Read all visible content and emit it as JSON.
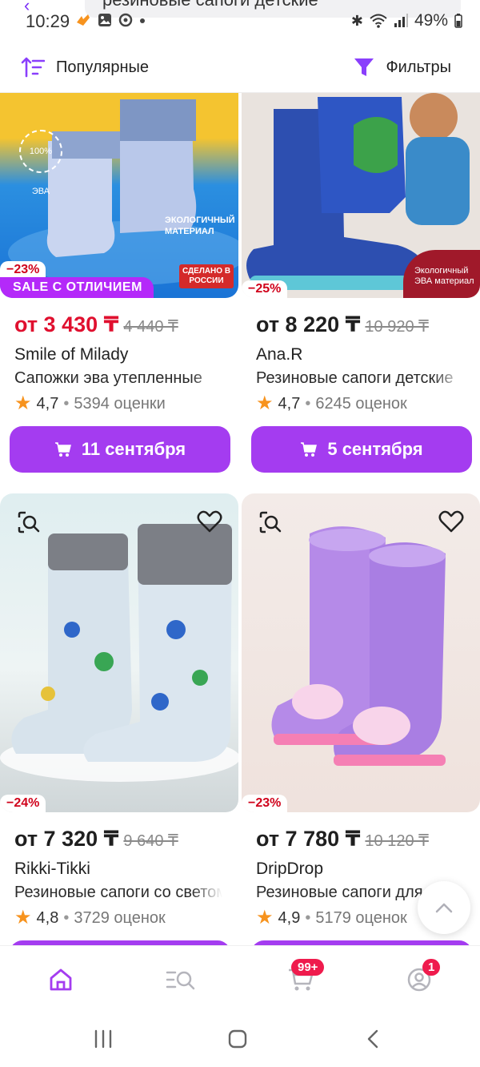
{
  "status": {
    "time": "10:29",
    "battery": "49%",
    "search_query": "резиновые сапоги детские"
  },
  "toolbar": {
    "sort_label": "Популярные",
    "filter_label": "Фильтры"
  },
  "products": [
    {
      "discount": "−23%",
      "sale_badge": "SALE С ОТЛИЧИЕМ",
      "price": "от 3 430 ₸",
      "old_price": "4 440 ₸",
      "brand": "Smile of Milady",
      "title": "Сапожки эва утепленные",
      "rating": "4,7",
      "reviews": "5394 оценки",
      "delivery": "11 сентября",
      "image_text": [
        "100% ЭВА",
        "ЭКОЛОГИЧНЫЙ МАТЕРИАЛ",
        "СДЕЛАНО В РОССИИ"
      ]
    },
    {
      "discount": "−25%",
      "price": "от 8 220 ₸",
      "old_price": "10 920 ₸",
      "brand": "Ana.R",
      "title": "Резиновые сапоги детские",
      "rating": "4,7",
      "reviews": "6245 оценок",
      "delivery": "5 сентября",
      "image_text": [
        "Экологичный ЭВА материал"
      ]
    },
    {
      "discount": "−24%",
      "price": "от 7 320 ₸",
      "old_price": "9 640 ₸",
      "brand": "Rikki-Tikki",
      "title": "Резиновые сапоги со светом",
      "rating": "4,8",
      "reviews": "3729 оценок"
    },
    {
      "discount": "−23%",
      "price": "от 7 780 ₸",
      "old_price": "10 120 ₸",
      "brand": "DripDrop",
      "title": "Резиновые сапоги для",
      "rating": "4,9",
      "reviews": "5179 оценок"
    }
  ],
  "bottom_nav": {
    "cart_badge": "99+",
    "profile_badge": "1"
  },
  "colors": {
    "accent": "#a43cf0",
    "price_red": "#e0102f",
    "star": "#f7931e",
    "badge": "#ef1b4d"
  }
}
